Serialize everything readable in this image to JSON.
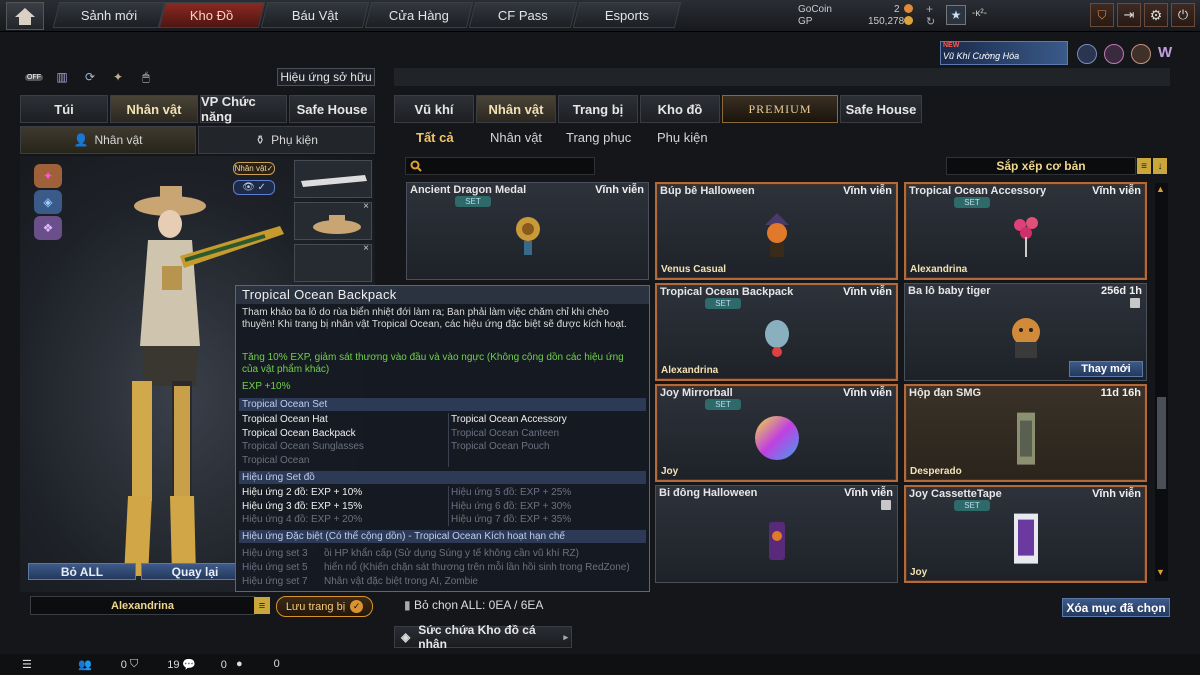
{
  "nav": {
    "tabs": [
      "Sảnh mới",
      "Kho Đồ",
      "Báu Vật",
      "Cửa Hàng",
      "CF Pass",
      "Esports"
    ],
    "active_tab": "Kho Đồ"
  },
  "currency": {
    "gocoin_label": "GoCoin",
    "gocoin_value": "2",
    "gp_label": "GP",
    "gp_value": "150,278"
  },
  "rank_text": "-ĸ²-",
  "promo_banner": {
    "badge": "NEW",
    "text": "Vũ Khí Cường Hóa"
  },
  "left": {
    "off_label": "OFF",
    "owned_effects_button": "Hiệu ứng sở hữu",
    "tabs": [
      "Túi",
      "Nhân vật",
      "VP Chức năng",
      "Safe House"
    ],
    "subtabs": [
      "Nhân vật",
      "Phụ kiện"
    ],
    "char_badge": "Nhân vật✓",
    "eye_badge": "👁 ✓",
    "reset_all_button": "Bỏ ALL",
    "back_button": "Quay lại",
    "character_name": "Alexandrina",
    "save_button": "Lưu trang bị"
  },
  "right": {
    "tabs": [
      "Vũ khí",
      "Nhân vật",
      "Trang bị",
      "Kho đồ"
    ],
    "premium_tab": "PREMIUM",
    "safehouse_tab": "Safe House",
    "filters": [
      "Tất cả",
      "Nhân vật",
      "Trang phục",
      "Phụ kiện"
    ],
    "sort_label": "Sắp xếp cơ bản",
    "cards": [
      {
        "name": "Ancient Dragon Medal",
        "duration": "Vĩnh viễn",
        "set": "SET",
        "owner": "",
        "owned": false
      },
      {
        "name": "Búp bê Halloween",
        "duration": "Vĩnh viễn",
        "set": "",
        "owner": "Venus Casual",
        "owned": true
      },
      {
        "name": "Tropical Ocean Accessory",
        "duration": "Vĩnh viễn",
        "set": "SET",
        "owner": "Alexandrina",
        "owned": true
      },
      {
        "name": "Tropical Ocean Backpack",
        "duration": "Vĩnh viễn",
        "set": "SET",
        "owner": "Alexandrina",
        "owned": true
      },
      {
        "name": "Ba lô baby tiger",
        "duration": "256d 1h",
        "set": "",
        "owner": "",
        "owned": false
      },
      {
        "name": "Joy Mirrorball",
        "duration": "Vĩnh viễn",
        "set": "SET",
        "owner": "Joy",
        "owned": true
      },
      {
        "name": "Hộp đạn SMG",
        "duration": "11d 16h",
        "set": "",
        "owner": "Desperado",
        "owned": true
      },
      {
        "name": "Bi đông Halloween",
        "duration": "Vĩnh viễn",
        "set": "",
        "owner": "",
        "owned": false
      },
      {
        "name": "Joy CassetteTape",
        "duration": "Vĩnh viễn",
        "set": "SET",
        "owner": "Joy",
        "owned": true
      }
    ],
    "change_button": "Thay mới",
    "deselect_all": "Bỏ chọn ALL: 0EA / 6EA",
    "clear_selected_button": "Xóa mục đã chọn",
    "capacity_label": "Sức chứa Kho đồ cá nhân"
  },
  "tooltip": {
    "title": "Tropical Ocean Backpack",
    "description": "Tham khảo ba lô do rùa biển nhiệt đới làm ra; Ban phải làm việc chăm chỉ khi chèo thuyền! Khi trang bị nhân vật Tropical Ocean, các hiệu ứng đặc biệt sẽ được kích hoạt.",
    "bonus_line": "Tăng 10% EXP, giảm sát thương vào đầu và vào ngực (Không cộng dồn các hiệu ứng của vật phẩm khác)",
    "exp_line": "EXP +10%",
    "set_header": "Tropical Ocean Set",
    "set_left": [
      {
        "text": "Tropical Ocean Hat",
        "on": true
      },
      {
        "text": "Tropical Ocean Backpack",
        "on": true
      },
      {
        "text": "Tropical Ocean Sunglasses",
        "on": false
      },
      {
        "text": "Tropical Ocean",
        "on": false
      }
    ],
    "set_right": [
      {
        "text": "Tropical Ocean Accessory",
        "on": true
      },
      {
        "text": "Tropical Ocean Canteen",
        "on": false
      },
      {
        "text": "Tropical Ocean Pouch",
        "on": false
      }
    ],
    "effect_header": "Hiệu ứng Set đồ",
    "effect_left": [
      {
        "text": "Hiệu ứng 2 đồ: EXP + 10%",
        "on": true
      },
      {
        "text": "Hiệu ứng 3 đồ: EXP + 15%",
        "on": true
      },
      {
        "text": "Hiệu ứng 4 đồ: EXP + 20%",
        "on": false
      }
    ],
    "effect_right": [
      {
        "text": "Hiệu ứng 5 đồ: EXP + 25%",
        "on": false
      },
      {
        "text": "Hiệu ứng 6 đồ: EXP + 30%",
        "on": false
      },
      {
        "text": "Hiệu ứng 7 đồ: EXP + 35%",
        "on": false
      }
    ],
    "special_header": "Hiệu ứng Đặc biệt (Có thể cộng dồn) - Tropical Ocean Kích hoạt hạn chế",
    "special": [
      {
        "label": "Hiệu ứng set 3",
        "text": "ồi HP khẩn cấp (Sử dụng Súng y tế không cần vũ khí RZ)"
      },
      {
        "label": "Hiệu ứng set 5",
        "text": "hiển nổ (Khiến chặn sát thương trên mỗi lần hồi sinh trong RedZone)"
      },
      {
        "label": "Hiệu ứng set 7",
        "text": "Nhân vật đặc biệt trong AI, Zombie"
      }
    ]
  },
  "bottom": {
    "stat1": "0",
    "stat2": "19",
    "stat3": "0",
    "stat4": "0"
  },
  "colors": {
    "accent": "#f3c468",
    "active_nav": "#8a2a22",
    "owned_border": "#b36a3a",
    "set_badge": "#2f6a6a",
    "button_blue": "#3e5a8a"
  }
}
